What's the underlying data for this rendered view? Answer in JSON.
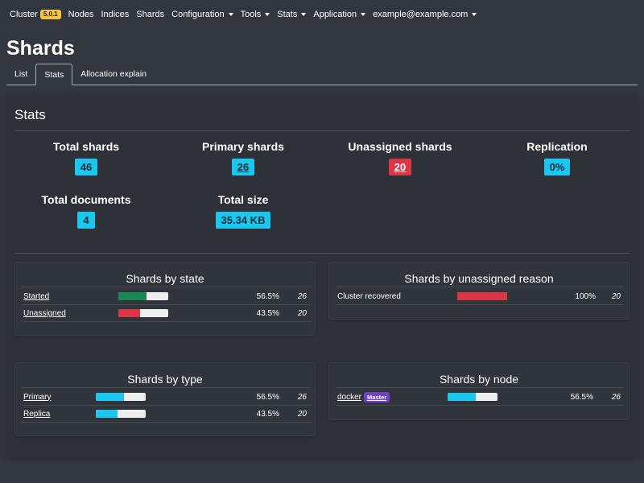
{
  "navbar": {
    "cluster_label": "Cluster",
    "version": "5.0.1",
    "items": [
      {
        "label": "Nodes",
        "dropdown": false
      },
      {
        "label": "Indices",
        "dropdown": false
      },
      {
        "label": "Shards",
        "dropdown": false
      },
      {
        "label": "Configuration",
        "dropdown": true
      },
      {
        "label": "Tools",
        "dropdown": true
      },
      {
        "label": "Stats",
        "dropdown": true
      },
      {
        "label": "Application",
        "dropdown": true
      },
      {
        "label": "example@example.com",
        "dropdown": true
      }
    ]
  },
  "page": {
    "title": "Shards",
    "tabs": [
      "List",
      "Stats",
      "Allocation explain"
    ],
    "active_tab": "Stats"
  },
  "stats": {
    "title": "Stats",
    "total_shards": {
      "label": "Total shards",
      "value": "46"
    },
    "primary_shards": {
      "label": "Primary shards",
      "value": "26"
    },
    "unassigned_shards": {
      "label": "Unassigned shards",
      "value": "20"
    },
    "replication": {
      "label": "Replication",
      "value": "0%"
    },
    "total_documents": {
      "label": "Total documents",
      "value": "4"
    },
    "total_size": {
      "label": "Total size",
      "value": "35.34 KB"
    }
  },
  "cards": {
    "by_state": {
      "title": "Shards by state",
      "rows": [
        {
          "label": "Started",
          "fraction": 0.565,
          "percent": "56.5%",
          "count": "26",
          "color": "#198754"
        },
        {
          "label": "Unassigned",
          "fraction": 0.435,
          "percent": "43.5%",
          "count": "20",
          "color": "#dc3545"
        }
      ]
    },
    "by_reason": {
      "title": "Shards by unassigned reason",
      "rows": [
        {
          "label": "Cluster recovered",
          "fraction": 1.0,
          "percent": "100%",
          "count": "20",
          "color": "#dc3545"
        }
      ]
    },
    "by_type": {
      "title": "Shards by type",
      "rows": [
        {
          "label": "Primary",
          "fraction": 0.565,
          "percent": "56.5%",
          "count": "26",
          "color": "#1ac8ef"
        },
        {
          "label": "Replica",
          "fraction": 0.435,
          "percent": "43.5%",
          "count": "20",
          "color": "#1ac8ef"
        }
      ]
    },
    "by_node": {
      "title": "Shards by node",
      "rows": [
        {
          "label": "docker",
          "badge": "Master",
          "fraction": 0.565,
          "percent": "56.5%",
          "count": "26",
          "color": "#1ac8ef"
        }
      ]
    }
  },
  "colors": {
    "background": "#32363f",
    "accent_info": "#1ac8ef",
    "danger": "#dc3545",
    "success": "#198754",
    "warning": "#f6c342",
    "master_badge": "#6f42c1"
  }
}
